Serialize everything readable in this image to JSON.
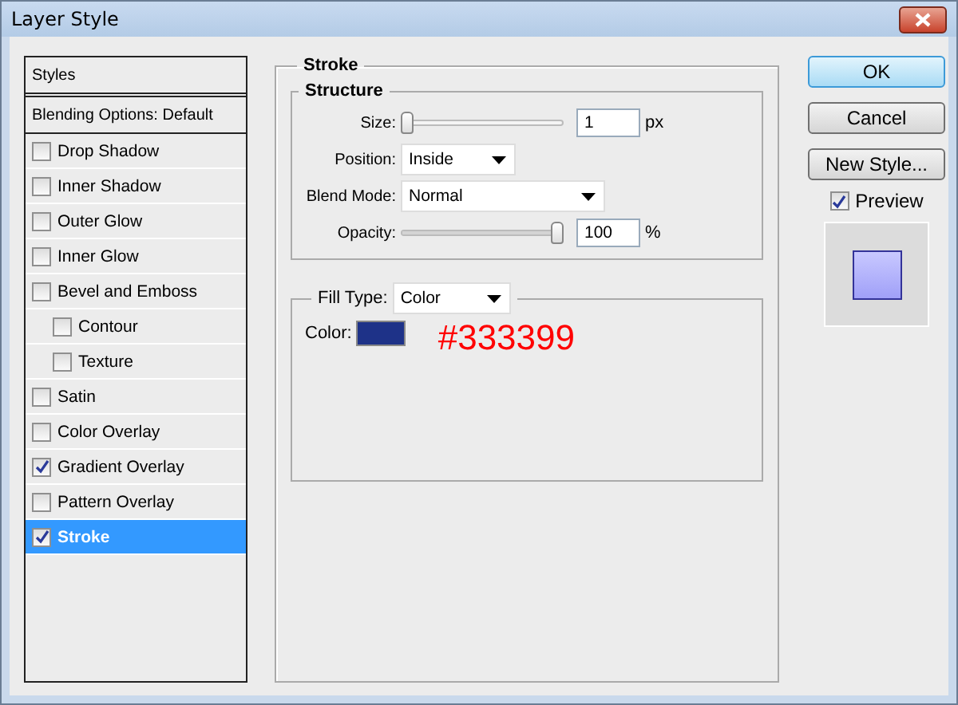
{
  "window": {
    "title": "Layer Style"
  },
  "styles_panel": {
    "header": "Styles",
    "blending": "Blending Options: Default",
    "items": [
      {
        "label": "Drop Shadow",
        "checked": false,
        "selected": false
      },
      {
        "label": "Inner Shadow",
        "checked": false,
        "selected": false
      },
      {
        "label": "Outer Glow",
        "checked": false,
        "selected": false
      },
      {
        "label": "Inner Glow",
        "checked": false,
        "selected": false
      },
      {
        "label": "Bevel and Emboss",
        "checked": false,
        "selected": false,
        "children": [
          {
            "label": "Contour",
            "checked": false,
            "selected": false
          },
          {
            "label": "Texture",
            "checked": false,
            "selected": false
          }
        ]
      },
      {
        "label": "Satin",
        "checked": false,
        "selected": false
      },
      {
        "label": "Color Overlay",
        "checked": false,
        "selected": false
      },
      {
        "label": "Gradient Overlay",
        "checked": true,
        "selected": false
      },
      {
        "label": "Pattern Overlay",
        "checked": false,
        "selected": false
      },
      {
        "label": "Stroke",
        "checked": true,
        "selected": true
      }
    ]
  },
  "stroke": {
    "title": "Stroke",
    "structure": {
      "title": "Structure",
      "size": {
        "label": "Size:",
        "level": 0,
        "value": "1",
        "unit": "px"
      },
      "position": {
        "label": "Position:",
        "value": "Inside"
      },
      "blend_mode": {
        "label": "Blend Mode:",
        "value": "Normal"
      },
      "opacity": {
        "label": "Opacity:",
        "level": 1,
        "value": "100",
        "unit": "%"
      }
    },
    "fill": {
      "label": "Fill Type:",
      "value": "Color",
      "color_label": "Color:",
      "color": "#1e3288",
      "annotation": "#333399"
    }
  },
  "buttons": [
    {
      "label": "OK",
      "kind": "default"
    },
    {
      "label": "Cancel",
      "kind": "normal"
    },
    {
      "label": "New Style...",
      "kind": "normal"
    }
  ],
  "preview": {
    "label": "Preview",
    "checked": true
  }
}
